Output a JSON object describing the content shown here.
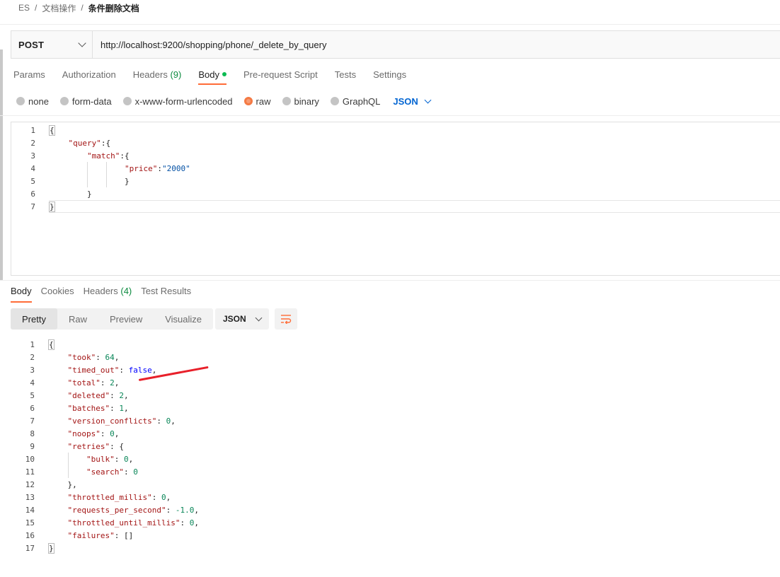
{
  "breadcrumb": [
    "ES",
    "文档操作",
    "条件删除文档"
  ],
  "request": {
    "method": "POST",
    "url": "http://localhost:9200/shopping/phone/_delete_by_query"
  },
  "request_tabs": [
    {
      "label": "Params"
    },
    {
      "label": "Authorization"
    },
    {
      "label": "Headers",
      "count": "(9)"
    },
    {
      "label": "Body",
      "active": true
    },
    {
      "label": "Pre-request Script"
    },
    {
      "label": "Tests"
    },
    {
      "label": "Settings"
    }
  ],
  "body_types": {
    "options": [
      "none",
      "form-data",
      "x-www-form-urlencoded",
      "raw",
      "binary",
      "GraphQL"
    ],
    "selected": "raw",
    "format": "JSON"
  },
  "request_body_lines": [
    {
      "n": "1",
      "text": "{"
    },
    {
      "n": "2",
      "text": "    \"query\":{"
    },
    {
      "n": "3",
      "text": "        \"match\":{"
    },
    {
      "n": "4",
      "text": "                \"price\":\"2000\""
    },
    {
      "n": "5",
      "text": "                }"
    },
    {
      "n": "6",
      "text": "        }"
    },
    {
      "n": "7",
      "text": "}"
    }
  ],
  "response_tabs": [
    {
      "label": "Body",
      "active": true
    },
    {
      "label": "Cookies"
    },
    {
      "label": "Headers",
      "count": "(4)"
    },
    {
      "label": "Test Results"
    }
  ],
  "view_modes": [
    "Pretty",
    "Raw",
    "Preview",
    "Visualize"
  ],
  "active_view": "Pretty",
  "response_format": "JSON",
  "response_lines": [
    {
      "n": "1",
      "text": "{"
    },
    {
      "n": "2",
      "text": "    \"took\": 64,"
    },
    {
      "n": "3",
      "text": "    \"timed_out\": false,"
    },
    {
      "n": "4",
      "text": "    \"total\": 2,"
    },
    {
      "n": "5",
      "text": "    \"deleted\": 2,"
    },
    {
      "n": "6",
      "text": "    \"batches\": 1,"
    },
    {
      "n": "7",
      "text": "    \"version_conflicts\": 0,"
    },
    {
      "n": "8",
      "text": "    \"noops\": 0,"
    },
    {
      "n": "9",
      "text": "    \"retries\": {"
    },
    {
      "n": "10",
      "text": "        \"bulk\": 0,"
    },
    {
      "n": "11",
      "text": "        \"search\": 0"
    },
    {
      "n": "12",
      "text": "    },"
    },
    {
      "n": "13",
      "text": "    \"throttled_millis\": 0,"
    },
    {
      "n": "14",
      "text": "    \"requests_per_second\": -1.0,"
    },
    {
      "n": "15",
      "text": "    \"throttled_until_millis\": 0,"
    },
    {
      "n": "16",
      "text": "    \"failures\": []"
    },
    {
      "n": "17",
      "text": "}"
    }
  ],
  "colors": {
    "accent": "#ff6c37",
    "link": "#0265d2",
    "json_key": "#a31515",
    "json_number": "#098658",
    "json_bool": "#0000ff",
    "annotation": "#e8202a"
  }
}
